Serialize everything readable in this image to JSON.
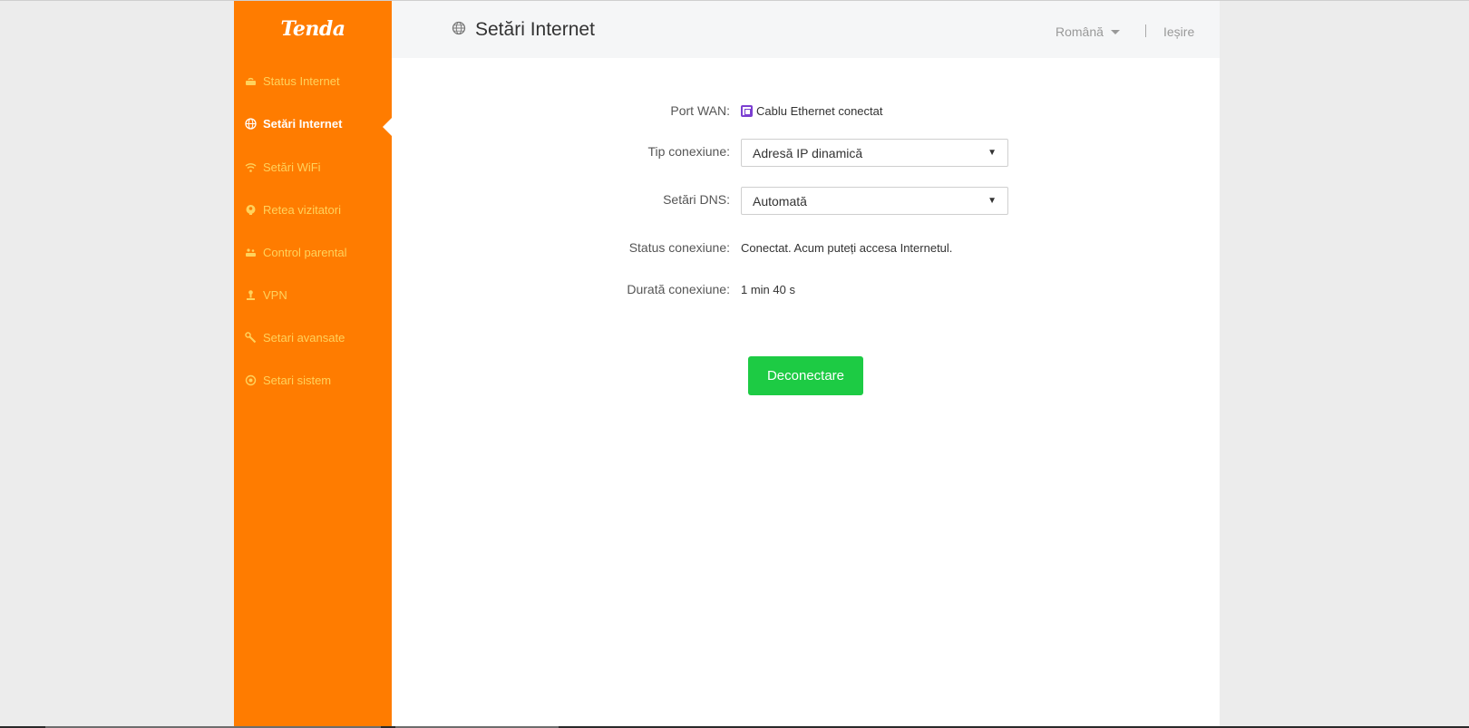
{
  "brand": {
    "logo_text": "Tenda",
    "accent_color": "#ff7c00",
    "success_color": "#1dcb44"
  },
  "sidebar": {
    "items": [
      {
        "label": "Status Internet",
        "icon": "router-status-icon",
        "active": false
      },
      {
        "label": "Setări Internet",
        "icon": "globe-icon",
        "active": true
      },
      {
        "label": "Setări WiFi",
        "icon": "wifi-icon",
        "active": false
      },
      {
        "label": "Retea vizitatori",
        "icon": "guest-network-icon",
        "active": false
      },
      {
        "label": "Control parental",
        "icon": "parental-control-icon",
        "active": false
      },
      {
        "label": "VPN",
        "icon": "vpn-icon",
        "active": false
      },
      {
        "label": "Setari avansate",
        "icon": "wrench-icon",
        "active": false
      },
      {
        "label": "Setari sistem",
        "icon": "gear-icon",
        "active": false
      }
    ]
  },
  "header": {
    "title": "Setări Internet",
    "title_icon": "globe-icon",
    "language": "Română",
    "logout": "Ieșire"
  },
  "form": {
    "wan_port": {
      "label": "Port WAN:",
      "value": "Cablu Ethernet conectat",
      "icon": "ethernet-port-icon"
    },
    "connection_type": {
      "label": "Tip conexiune:",
      "value": "Adresă IP dinamică"
    },
    "dns": {
      "label": "Setări DNS:",
      "value": "Automată"
    },
    "status": {
      "label": "Status conexiune:",
      "value": "Conectat. Acum puteți accesa Internetul."
    },
    "duration": {
      "label": "Durată conexiune:",
      "value": "1 min 40 s"
    },
    "disconnect_button": "Deconectare"
  }
}
